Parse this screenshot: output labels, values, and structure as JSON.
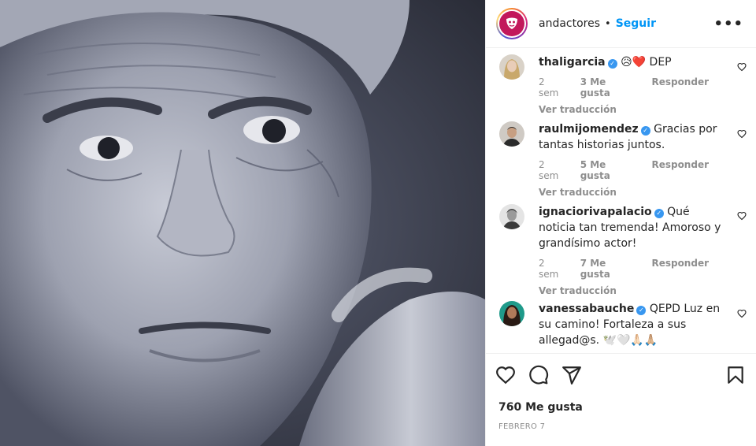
{
  "post": {
    "account": "andactores",
    "separator": "•",
    "follow_label": "Seguir",
    "more_label": "•••"
  },
  "comments": [
    {
      "username": "thaligarcia",
      "verified": true,
      "text": "😥❤️ DEP",
      "time": "2 sem",
      "likes": "3 Me gusta",
      "reply": "Responder",
      "translate": "Ver traducción"
    },
    {
      "username": "raulmijomendez",
      "verified": true,
      "text": "Gracias por tantas historias juntos.",
      "time": "2 sem",
      "likes": "5 Me gusta",
      "reply": "Responder",
      "translate": "Ver traducción"
    },
    {
      "username": "ignaciorivapalacio",
      "verified": true,
      "text": "Qué noticia tan tremenda! Amoroso y grandísimo actor!",
      "time": "2 sem",
      "likes": "7 Me gusta",
      "reply": "Responder",
      "translate": "Ver traducción"
    },
    {
      "username": "vanessabauche",
      "verified": true,
      "text": "QEPD Luz en su camino! Fortaleza a sus allegad@s. 🕊️🤍🙏🏻🙏🏼",
      "time": "",
      "likes": "",
      "reply": "",
      "translate": ""
    }
  ],
  "footer": {
    "likes_count": "760 Me gusta",
    "date": "FEBRERO 7"
  },
  "icons": {
    "like": "heart-icon",
    "comment": "comment-icon",
    "share": "share-icon",
    "save": "bookmark-icon",
    "more": "more-icon"
  },
  "colors": {
    "accent": "#0095f6",
    "verified": "#3897f0",
    "muted": "#8e8e8e",
    "text": "#262626"
  }
}
